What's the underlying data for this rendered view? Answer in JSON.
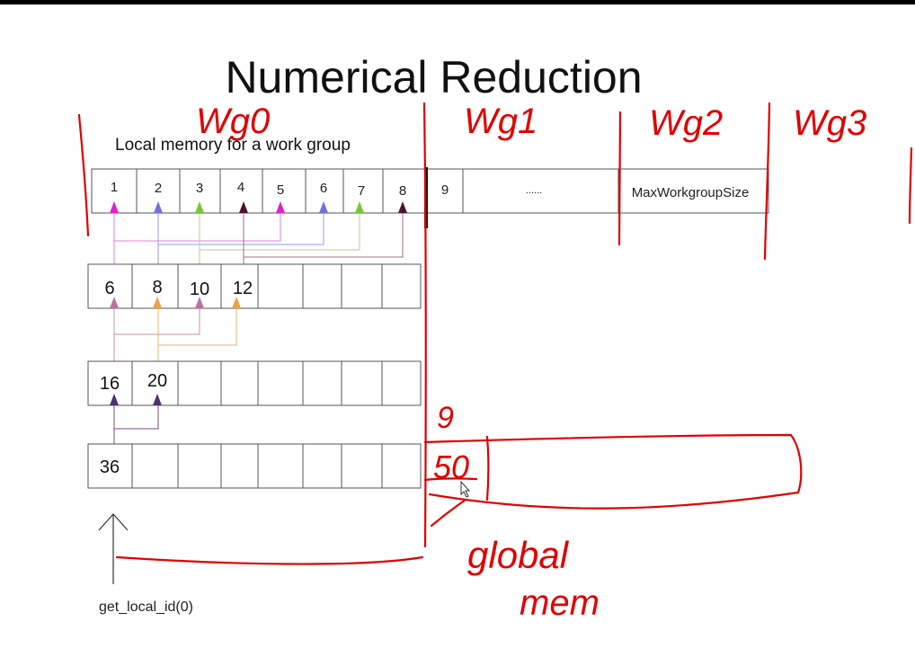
{
  "title": "Numerical Reduction",
  "caption": "Local memory for a work group",
  "local_id_label": "get_local_id(0)",
  "top_row": {
    "labels": [
      "1",
      "2",
      "3",
      "4",
      "5",
      "6",
      "7",
      "8",
      "9",
      "......",
      "MaxWorkgroupSize"
    ],
    "arrow_colors": [
      "#e020c8",
      "#7070e0",
      "#78c830",
      "#501030",
      "#e020c8",
      "#7070e0",
      "#78c830",
      "#501030"
    ]
  },
  "row2": {
    "values": [
      "6",
      "8",
      "10",
      "12",
      "",
      "",
      "",
      ""
    ],
    "arrow_colors": [
      "#c070a0",
      "#f0a040",
      "#c070a0",
      "#f0a040"
    ]
  },
  "row3": {
    "values": [
      "16",
      "20",
      "",
      "",
      "",
      "",
      "",
      ""
    ],
    "arrow_colors": [
      "#503070",
      "#503070"
    ]
  },
  "row4": {
    "values": [
      "36",
      "",
      "",
      "",
      "",
      "",
      "",
      ""
    ]
  },
  "annotations": {
    "wg0": "Wg0",
    "wg1": "Wg1",
    "wg2": "Wg2",
    "wg3": "Wg3",
    "partial_top": "9",
    "partial_sum": "50",
    "global_mem_1": "global",
    "global_mem_2": "mem",
    "ink_color": "#e00000"
  }
}
